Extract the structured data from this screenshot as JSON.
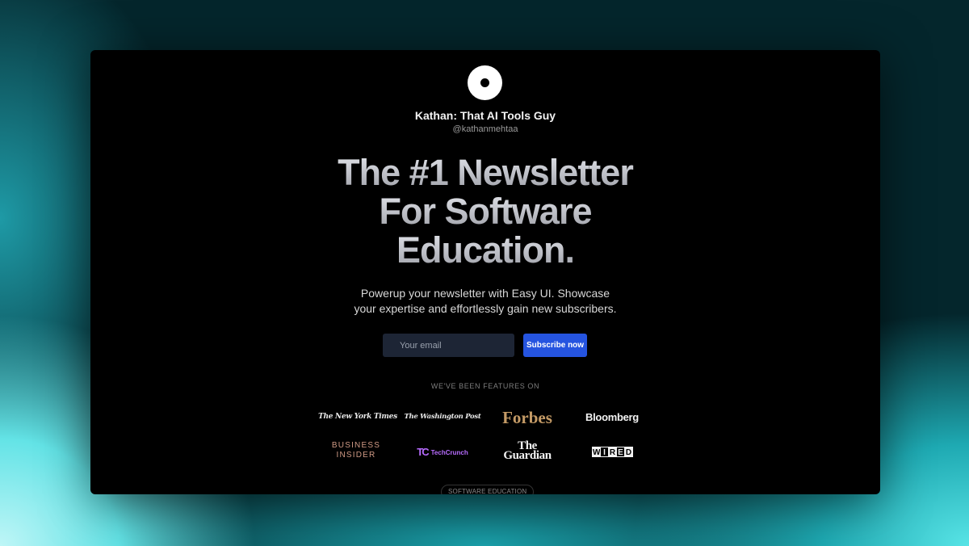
{
  "profile": {
    "name": "Kathan: That AI Tools Guy",
    "handle": "@kathanmehtaa"
  },
  "hero": {
    "headline_lines": [
      "The #1 Newsletter",
      "For Software",
      "Education."
    ],
    "description_lines": [
      "Powerup your newsletter with Easy UI. Showcase",
      "your expertise and effortlessly gain new subscribers."
    ]
  },
  "subscribe_form": {
    "email_placeholder": "Your email",
    "button_label": "Subscribe now"
  },
  "featured": {
    "heading": "WE'VE BEEN FEATURES ON",
    "logos": {
      "nyt": "The New York Times",
      "wapo": "The Washington Post",
      "forbes": "Forbes",
      "bloomberg": "Bloomberg",
      "business_insider": [
        "BUSINESS",
        "INSIDER"
      ],
      "techcrunch": {
        "mark": "TC",
        "text": "TechCrunch"
      },
      "guardian": [
        "The",
        "Guardian"
      ],
      "wired": [
        "W",
        "I",
        "R",
        "E",
        "D"
      ]
    }
  },
  "footer_tag": "SOFTWARE EDUCATION",
  "colors": {
    "subscribe_button": "#2554e0",
    "forbes": "#c59b66",
    "business_insider": "#d09a85",
    "techcrunch": "#b86cff"
  }
}
